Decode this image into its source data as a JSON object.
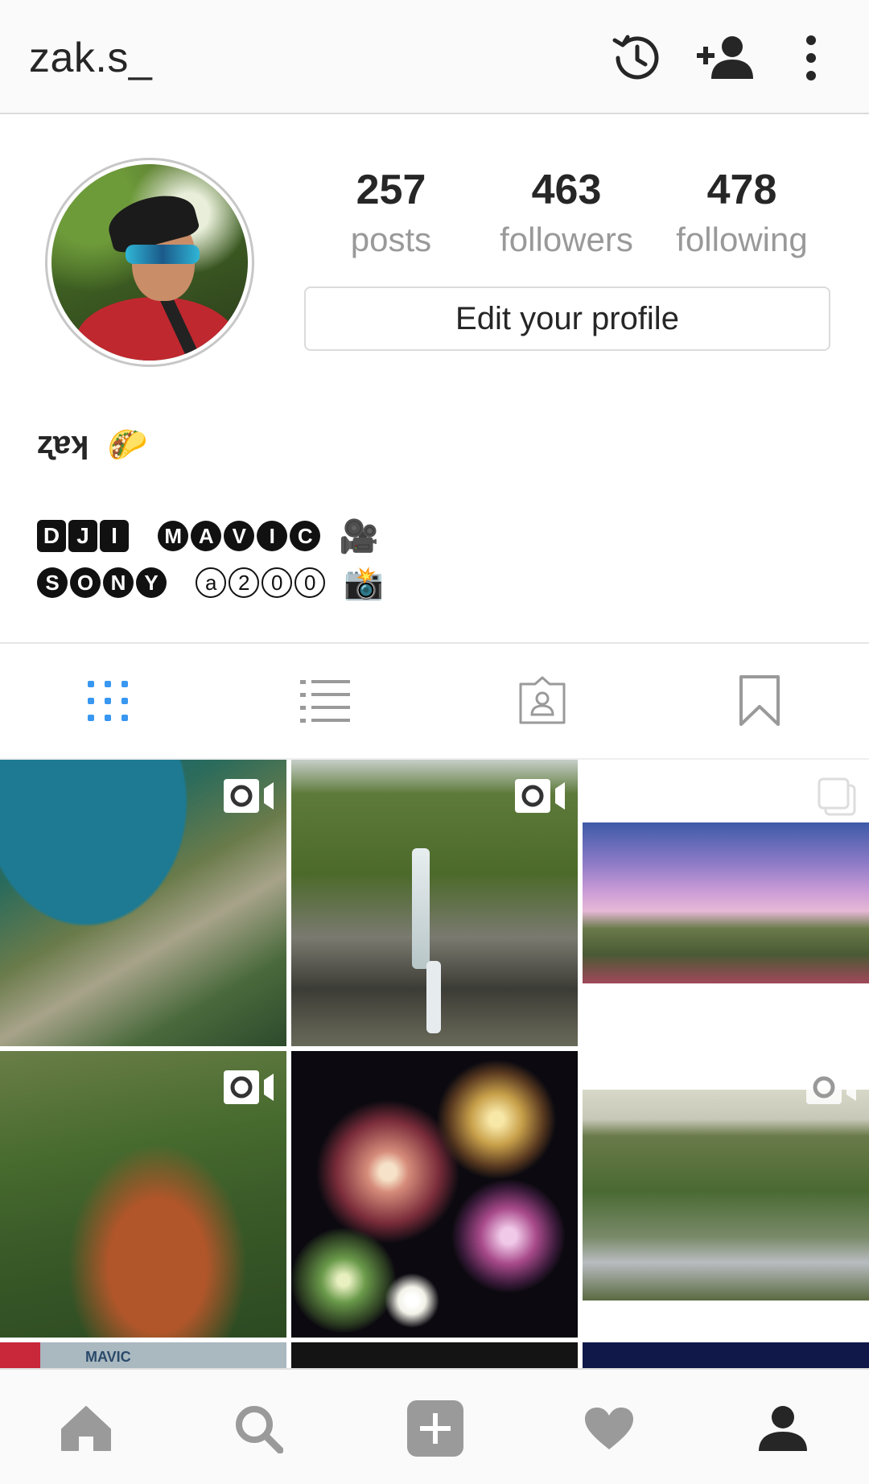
{
  "header": {
    "username": "zak.s_",
    "icons": [
      "history-icon",
      "add-person-icon",
      "more-vertical-icon"
    ]
  },
  "profile": {
    "stats": [
      {
        "value": "257",
        "label": "posts"
      },
      {
        "value": "463",
        "label": "followers"
      },
      {
        "value": "478",
        "label": "following"
      }
    ],
    "edit_button_label": "Edit your profile"
  },
  "bio": {
    "name": "ʐɐʞ",
    "line1_part1": [
      "D",
      "J",
      "I"
    ],
    "line1_part2": [
      "M",
      "A",
      "V",
      "I",
      "C"
    ],
    "line2_part1": [
      "S",
      "O",
      "N",
      "Y"
    ],
    "line2_part2": [
      "a",
      "2",
      "0",
      "0"
    ],
    "emoji_taco": "🌮",
    "emoji_camera_movie": "🎥",
    "emoji_camera_flash": "📸"
  },
  "tabs": [
    {
      "name": "grid-view",
      "active": true
    },
    {
      "name": "list-view",
      "active": false
    },
    {
      "name": "tagged",
      "active": false
    },
    {
      "name": "saved",
      "active": false
    }
  ],
  "grid": [
    {
      "scene": "coastline aerial",
      "badge": "video"
    },
    {
      "scene": "waterfall canyon",
      "badge": "video"
    },
    {
      "scene": "sunset hillside town",
      "badge": "carousel"
    },
    {
      "scene": "green hills aerial",
      "badge": "video"
    },
    {
      "scene": "fireworks",
      "badge": "none"
    },
    {
      "scene": "forest neighborhood",
      "badge": "video"
    },
    {
      "scene": "mavic box",
      "badge": "none"
    },
    {
      "scene": "dark",
      "badge": "none"
    },
    {
      "scene": "night",
      "badge": "none"
    }
  ],
  "grid_partial_label": "MAVIC",
  "colors": {
    "active_tab": "#3897f0",
    "inactive_icon": "#9a9a9a",
    "text": "#262626",
    "muted": "#999999"
  },
  "bottom_nav": [
    "home-icon",
    "search-icon",
    "add-post-icon",
    "heart-icon",
    "profile-icon"
  ]
}
